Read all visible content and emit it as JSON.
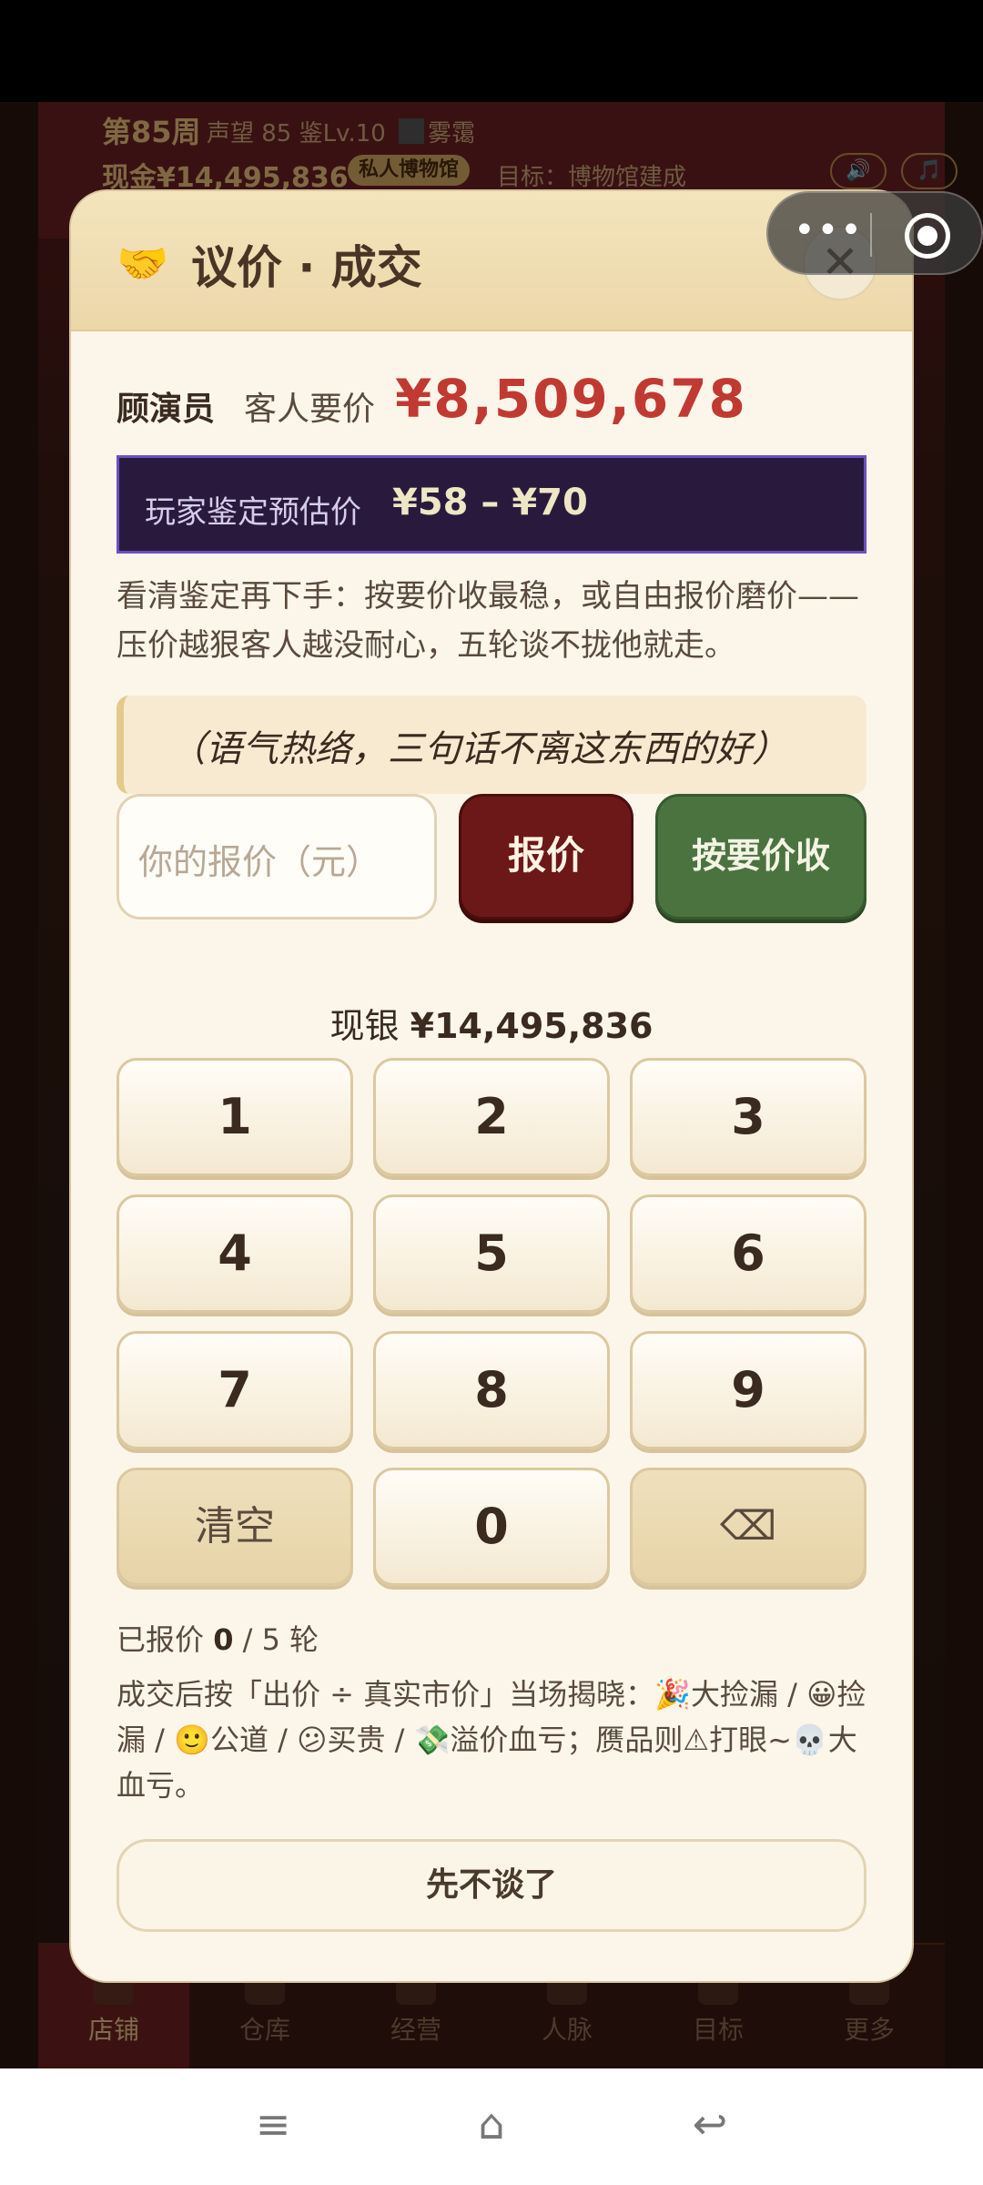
{
  "header": {
    "week": "第85周",
    "stats": "声望 85  鉴Lv.10",
    "weather": "雾霭",
    "cash": "现金¥14,495,836",
    "museum_badge": "私人博物馆",
    "goal": "目标：博物馆建成",
    "sound_icon": "🔊",
    "music_icon": "🎵"
  },
  "tabs": [
    {
      "label": "店铺",
      "icon": "shop-icon",
      "active": true
    },
    {
      "label": "仓库",
      "icon": "warehouse-icon",
      "active": false
    },
    {
      "label": "经营",
      "icon": "business-icon",
      "active": false
    },
    {
      "label": "人脉",
      "icon": "people-icon",
      "active": false
    },
    {
      "label": "目标",
      "icon": "target-icon",
      "active": false
    },
    {
      "label": "更多",
      "icon": "more-icon",
      "active": false
    }
  ],
  "dialog": {
    "icon": "🤝",
    "title": "议价 · 成交",
    "close": "✕",
    "customer_name": "顾演员",
    "ask_label": "客人要价",
    "ask_price": "¥8,509,678",
    "appraisal_label": "玩家鉴定预估价",
    "appraisal_range": "¥58 – ¥70",
    "hint": "看清鉴定再下手：按要价收最稳，或自由报价磨价——压价越狠客人越没耐心，五轮谈不拢他就走。",
    "quote": "（语气热络，三句话不离这东西的好）",
    "price_placeholder": "你的报价（元）",
    "offer_button": "报价",
    "accept_button": "按要价收",
    "cash_prefix": "现银",
    "cash_value": "¥14,495,836",
    "keys": [
      "1",
      "2",
      "3",
      "4",
      "5",
      "6",
      "7",
      "8",
      "9",
      "清空",
      "0",
      "⌫"
    ],
    "rounds_prefix": "已报价",
    "rounds_done": "0",
    "rounds_suffix": "/ 5 轮",
    "reveal": "成交后按「出价 ÷ 真实市价」当场揭晓：🎉大捡漏 / 😀捡漏 / 🙂公道 / 😕买贵 / 💸溢价血亏；赝品则⚠打眼~💀大血亏。",
    "skip_button": "先不谈了"
  },
  "miniprogram": {
    "menu": "•••",
    "target_icon": "target-icon"
  },
  "navbar": {
    "menu": "≡",
    "home": "⌂",
    "back": "↩"
  }
}
